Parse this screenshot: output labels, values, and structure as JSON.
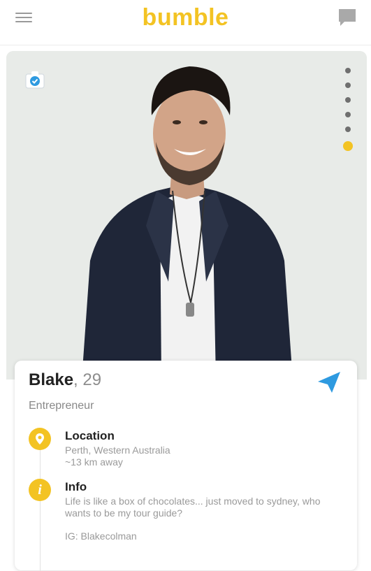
{
  "header": {
    "logo": "bumble",
    "menu_icon": "hamburger-menu-icon",
    "chat_icon": "chat-bubble-icon",
    "brand_color": "#f3c323"
  },
  "photo": {
    "verified_icon": "verified-camera-icon",
    "page_count": 6,
    "active_index": 5
  },
  "profile": {
    "name": "Blake",
    "age": ", 29",
    "job": "Entrepreneur",
    "send_icon": "paper-plane-icon",
    "location": {
      "title": "Location",
      "line1": "Perth, Western Australia",
      "line2": "~13 km away"
    },
    "info": {
      "title": "Info",
      "bio": "Life is like a box of chocolates... just moved to sydney, who wants to be my tour guide?",
      "ig": "IG: Blakecolman"
    }
  }
}
